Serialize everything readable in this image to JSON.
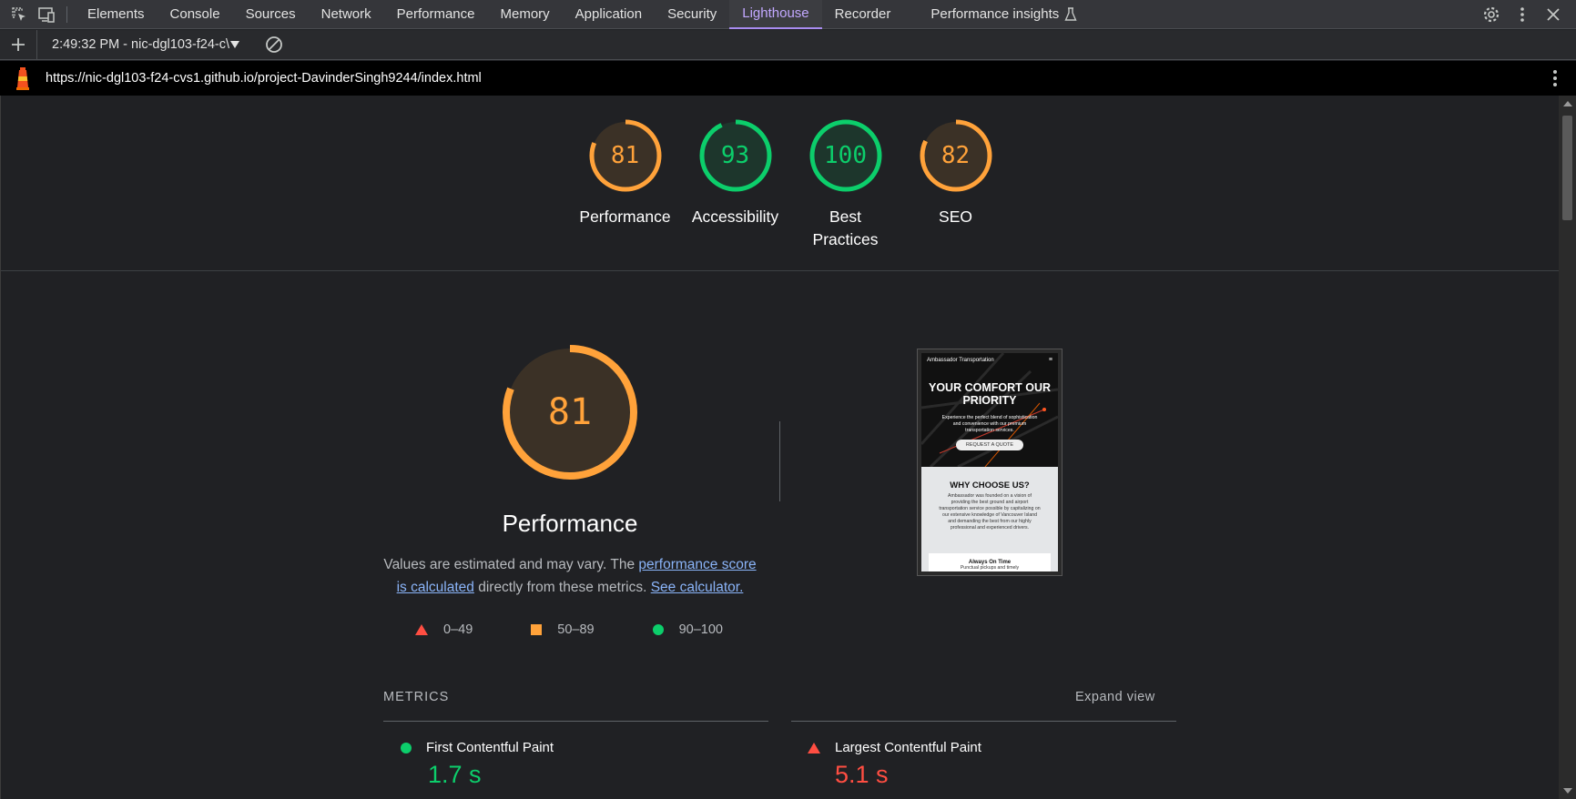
{
  "devtools": {
    "tabs": [
      "Elements",
      "Console",
      "Sources",
      "Network",
      "Performance",
      "Memory",
      "Application",
      "Security",
      "Lighthouse",
      "Recorder",
      "Performance insights"
    ],
    "active_tab": "Lighthouse"
  },
  "lighthouse_toolbar": {
    "report_select": "2:49:32 PM - nic-dgl103-f24-c\\"
  },
  "url": "https://nic-dgl103-f24-cvs1.github.io/project-DavinderSingh9244/index.html",
  "scores": [
    {
      "value": "81",
      "label": "Performance",
      "color": "#ffa23a"
    },
    {
      "value": "93",
      "label": "Accessibility",
      "color": "#0cce6b"
    },
    {
      "value": "100",
      "label": "Best Practices",
      "color": "#0cce6b"
    },
    {
      "value": "82",
      "label": "SEO",
      "color": "#ffa23a"
    }
  ],
  "performance": {
    "score": "81",
    "title": "Performance",
    "desc_prefix": "Values are estimated and may vary. The ",
    "link1": "performance score is calculated",
    "desc_mid": " directly from these metrics. ",
    "link2": "See calculator.",
    "legend": [
      {
        "range": "0–49",
        "shape": "triangle",
        "color": "#ff4e42"
      },
      {
        "range": "50–89",
        "shape": "square",
        "color": "#ffa23a"
      },
      {
        "range": "90–100",
        "shape": "circle",
        "color": "#0cce6b"
      }
    ]
  },
  "screenshot": {
    "brand": "Ambassador Transportation",
    "menu": "≡",
    "hero_title": "YOUR COMFORT OUR PRIORITY",
    "hero_sub": "Experience the perfect blend of sophistication and convenience with our premium transportation services.",
    "hero_button": "REQUEST A QUOTE",
    "section_title": "WHY CHOOSE US?",
    "section_text": "Ambassador was founded on a vision of providing the best ground and airport transportation service possible by capitalizing on our extensive knowledge of Vancouver Island and demanding the best from our highly professional and experienced drivers.",
    "card_title": "Always On Time",
    "card_text": "Punctual pickups and timely"
  },
  "metrics": {
    "heading": "METRICS",
    "expand": "Expand view",
    "items": [
      {
        "label": "First Contentful Paint",
        "value": "1.7 s",
        "color": "#0cce6b"
      },
      {
        "label": "Largest Contentful Paint",
        "value": "5.1 s",
        "color": "#ff4e42"
      }
    ]
  }
}
